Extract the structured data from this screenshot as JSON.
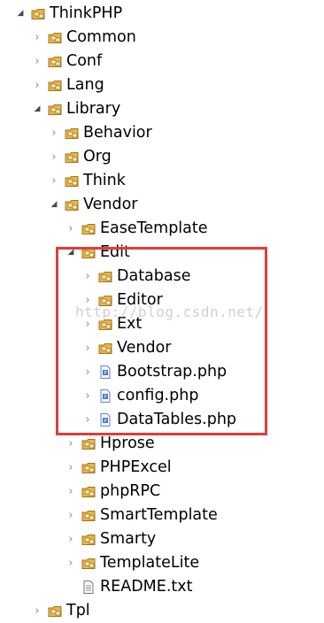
{
  "tree": [
    {
      "label": "ThinkPHP",
      "depth": 0,
      "type": "package",
      "state": "expanded"
    },
    {
      "label": "Common",
      "depth": 1,
      "type": "package",
      "state": "collapsed"
    },
    {
      "label": "Conf",
      "depth": 1,
      "type": "package",
      "state": "collapsed"
    },
    {
      "label": "Lang",
      "depth": 1,
      "type": "package",
      "state": "collapsed"
    },
    {
      "label": "Library",
      "depth": 1,
      "type": "package",
      "state": "expanded"
    },
    {
      "label": "Behavior",
      "depth": 2,
      "type": "package",
      "state": "collapsed"
    },
    {
      "label": "Org",
      "depth": 2,
      "type": "package",
      "state": "collapsed"
    },
    {
      "label": "Think",
      "depth": 2,
      "type": "package",
      "state": "collapsed"
    },
    {
      "label": "Vendor",
      "depth": 2,
      "type": "package",
      "state": "expanded"
    },
    {
      "label": "EaseTemplate",
      "depth": 3,
      "type": "package",
      "state": "collapsed"
    },
    {
      "label": "Edit",
      "depth": 3,
      "type": "package",
      "state": "expanded"
    },
    {
      "label": "Database",
      "depth": 4,
      "type": "package",
      "state": "collapsed"
    },
    {
      "label": "Editor",
      "depth": 4,
      "type": "package",
      "state": "collapsed"
    },
    {
      "label": "Ext",
      "depth": 4,
      "type": "package",
      "state": "collapsed"
    },
    {
      "label": "Vendor",
      "depth": 4,
      "type": "package",
      "state": "collapsed"
    },
    {
      "label": "Bootstrap.php",
      "depth": 4,
      "type": "php",
      "state": "collapsed"
    },
    {
      "label": "config.php",
      "depth": 4,
      "type": "php",
      "state": "collapsed"
    },
    {
      "label": "DataTables.php",
      "depth": 4,
      "type": "php",
      "state": "collapsed"
    },
    {
      "label": "Hprose",
      "depth": 3,
      "type": "package",
      "state": "collapsed"
    },
    {
      "label": "PHPExcel",
      "depth": 3,
      "type": "package",
      "state": "collapsed"
    },
    {
      "label": "phpRPC",
      "depth": 3,
      "type": "package",
      "state": "collapsed"
    },
    {
      "label": "SmartTemplate",
      "depth": 3,
      "type": "package",
      "state": "collapsed"
    },
    {
      "label": "Smarty",
      "depth": 3,
      "type": "package",
      "state": "collapsed"
    },
    {
      "label": "TemplateLite",
      "depth": 3,
      "type": "package",
      "state": "collapsed"
    },
    {
      "label": "README.txt",
      "depth": 3,
      "type": "text",
      "state": "leaf"
    },
    {
      "label": "Tpl",
      "depth": 1,
      "type": "package",
      "state": "collapsed"
    }
  ],
  "watermark": "http://blog.csdn.net/",
  "colors": {
    "highlight_border": "#e03c3c",
    "package_icon": "#e8b54a",
    "php_icon": "#4a78c8"
  }
}
